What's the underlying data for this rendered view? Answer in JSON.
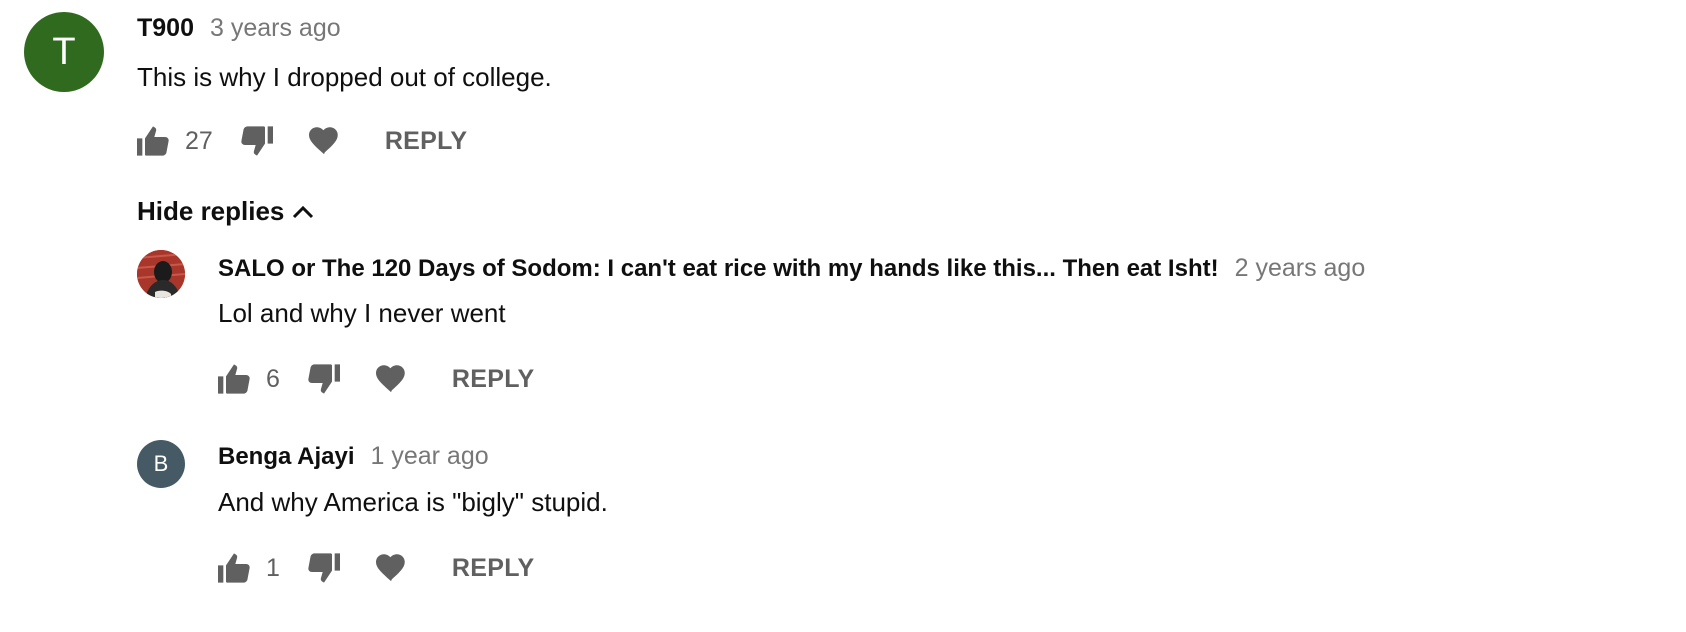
{
  "comments": [
    {
      "avatar_letter": "T",
      "avatar_color": "#2f6a1e",
      "author": "T900",
      "time": "3 years ago",
      "text": "This is why I dropped out of college.",
      "likes": "27",
      "reply_label": "REPLY"
    }
  ],
  "replies_toggle": {
    "label": "Hide replies",
    "icon": "chevron-up-icon"
  },
  "replies": [
    {
      "avatar_type": "image",
      "author": "SALO or The 120 Days of Sodom: I can't eat rice with my hands like this... Then eat Isht!",
      "time": "2 years ago",
      "text": "Lol and why I never went",
      "likes": "6",
      "reply_label": "REPLY"
    },
    {
      "avatar_letter": "B",
      "avatar_color": "#455a64",
      "author": "Benga Ajayi",
      "time": "1 year ago",
      "text": "And why America is \"bigly\" stupid.",
      "likes": "1",
      "reply_label": "REPLY"
    }
  ],
  "colors": {
    "icon_gray": "#606060",
    "timestamp_gray": "#777777",
    "text": "#0f0f0f"
  }
}
